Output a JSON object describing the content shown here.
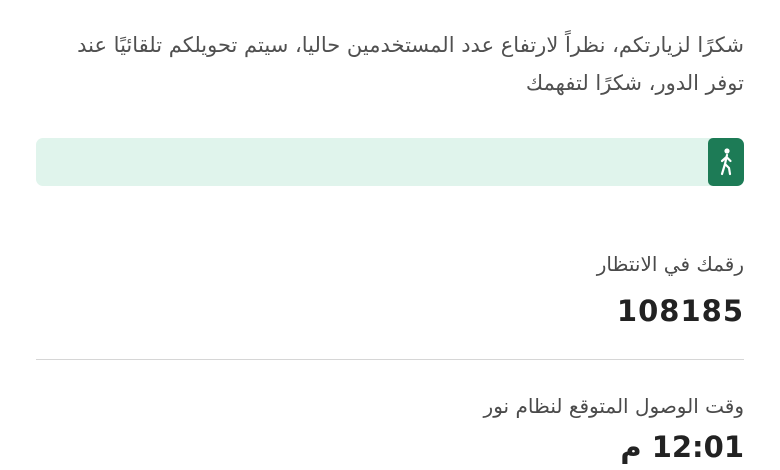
{
  "notice": {
    "text": "شكرًا لزيارتكم، نظراً لارتفاع عدد المستخدمين حاليا، سيتم تحويلكم تلقائيًا عند توفر الدور، شكرًا لتفهمك"
  },
  "queue_progress": {
    "fraction": 0.0,
    "icon": "walking-person-icon",
    "track_color": "#e0f4ec",
    "badge_color": "#1d7b56"
  },
  "queue_number": {
    "label": "رقمك في الانتظار",
    "value": "108185"
  },
  "arrival": {
    "label": "وقت الوصول المتوقع لنظام نور",
    "time": "12:01",
    "period": "م"
  }
}
